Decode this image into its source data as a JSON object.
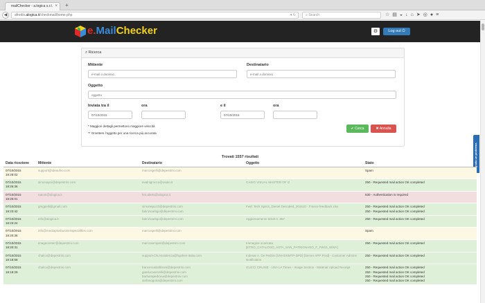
{
  "browser": {
    "tab_title": "mailChecker - a.logica s.r.l.",
    "url_prefix": "afredis.",
    "url_domain": "alogica.it",
    "url_suffix": "/checkmail/home.php",
    "search_placeholder": "Search"
  },
  "app": {
    "logo_e": "e.",
    "logo_mail": "Mail",
    "logo_checker": "Checker",
    "logout_label": "Log out"
  },
  "search": {
    "panel_title": "Ricerca",
    "mittente_label": "Mittente",
    "mittente_placeholder": "e-mail o dominio",
    "destinatario_label": "Destinatario",
    "destinatario_placeholder": "e-mail o dominio",
    "oggetto_label": "Oggetto",
    "oggetto_placeholder": "oggetto",
    "inviata_label": "Inviata tra il",
    "ora_label_1": "ora",
    "e_il_label": "e il",
    "ora_label_2": "ora",
    "date_from": "07/10/2015",
    "date_to": "07/10/2015",
    "note_1": "* Maggiori dettagli permettono maggiore velocità",
    "note_2": "** Omettere l'oggetto per una ricerca più accurata",
    "search_button": "Cerca",
    "cancel_button": "Annulla"
  },
  "side_tab_label": "Segnala un problema",
  "results": {
    "found_text": "Trovati 1557 risultati",
    "columns": [
      "Data ricezione",
      "Mittente",
      "Destinatario",
      "Oggetto",
      "Stato"
    ],
    "rows": [
      {
        "status": "spam",
        "date": "07/10/2015",
        "time": "18:28:02",
        "from": "support@ideaufvo.com",
        "to": "marcospelli@depestrini.com",
        "subject": "",
        "state": [
          "Spam"
        ]
      },
      {
        "status": "ok",
        "date": "07/10/2015",
        "time": "18:26:36",
        "from": "simonapzi@depestrini.com",
        "to": "evalnigrocco@osato.it",
        "subject": "CASIO VISUAL MASTER OF G",
        "state": [
          "250 - Requested mail action OK completed"
        ]
      },
      {
        "status": "err",
        "date": "07/10/2015",
        "time": "18:25:01",
        "from": "natoni@alogica.it",
        "to": "hrs.alerts@alogica.it",
        "subject": "",
        "state": [
          "530 - Authentication is required"
        ]
      },
      {
        "status": "ok",
        "date": "07/10/2015",
        "time": "18:23:42",
        "from": "gmgpelli@gmail.com",
        "to": "simonepozzi@depestrini.com",
        "to2": "fabrizioaritgo@depestrini.com",
        "subject": "Fwd: Tech Specs_Diesel Descaled_201510 - France feedback.xlsx",
        "state": [
          "250 - Requested mail action OK completed",
          "250 - Requested mail action OK completed"
        ]
      },
      {
        "status": "ok",
        "date": "07/10/2015",
        "time": "18:23:24",
        "from": "info@alogica.it",
        "to": "fabrizioaritgo@depestrini.com",
        "subject": "Aggiornamento ticket n. 867",
        "state": [
          "250 - Requested mail action OK completed"
        ]
      },
      {
        "status": "spam",
        "date": "07/10/2015",
        "time": "18:20:36",
        "from": "info@mediaplusbusinesspecialties.com",
        "to": "marcospelli@depestrini.com",
        "subject": "",
        "state": [
          "Spam"
        ]
      },
      {
        "status": "ok",
        "date": "07/10/2015",
        "time": "18:20:31",
        "from": "imagecenter@depestrini.com",
        "to": "marcosemperi@depestrini.com",
        "subject": "Immagine scaricata [ETRO_CATALOGO_ASTA_SAN_PATRIGNANO_F_FW15_WWA]",
        "state": [
          "250 - Requested mail action OK completed"
        ]
      },
      {
        "status": "ok",
        "date": "07/10/2015",
        "time": "18:18:58",
        "from": "chalco@depestrini.com",
        "to": "support-CN.Assistenza@hyphen-italia.com",
        "subject": "Indesar A. De Pedrini [VM-IDSMTP-DPD] [Server APP Prod] - Customer Admins Notification",
        "state": [
          "250 - Requested mail action OK completed"
        ]
      },
      {
        "status": "ok",
        "date": "07/10/2015",
        "time": "18:18:29",
        "from": "chalco@depestrini.com",
        "to": "francescabollinoni@depestrini.com",
        "to2": "gianlucaserrelli@depestrini.com",
        "to3": "barbarapedrona@depestrini.com",
        "to4": "stefanogoria@depestrini.com",
        "subject": "GUCCI CRUISE - USA LA Times - Image Section - Material Upload Receipt",
        "state": [
          "250 - Requested mail action OK completed",
          "250 - Requested mail action OK completed",
          "250 - Requested mail action OK completed",
          "250 - Requested mail action OK completed"
        ]
      }
    ]
  }
}
